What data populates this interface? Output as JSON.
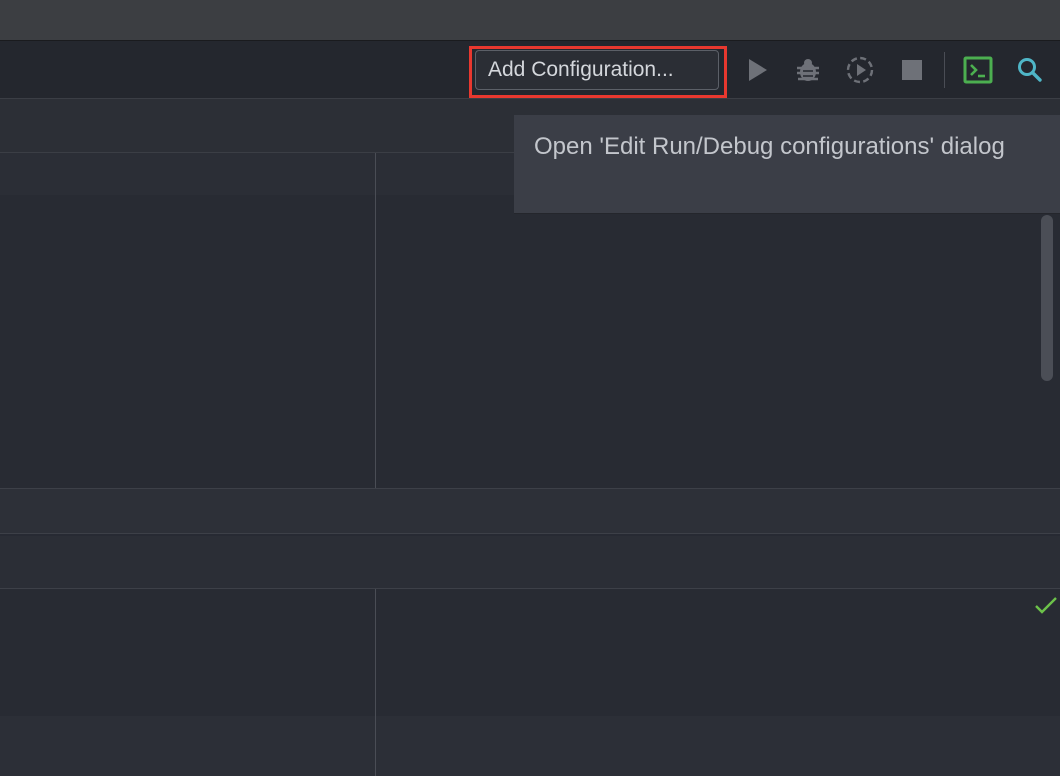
{
  "toolbar": {
    "config_button_label": "Add Configuration...",
    "icons": [
      "run-icon",
      "debug-icon",
      "run-with-coverage-icon",
      "stop-icon",
      "terminal-icon",
      "search-icon"
    ]
  },
  "tooltip": {
    "text": "Open 'Edit Run/Debug configurations' dialog"
  },
  "colors": {
    "highlight": "#e8382f",
    "terminal_green": "#4caf50",
    "search_teal": "#4fb6c7",
    "check_green": "#6cc24a"
  }
}
